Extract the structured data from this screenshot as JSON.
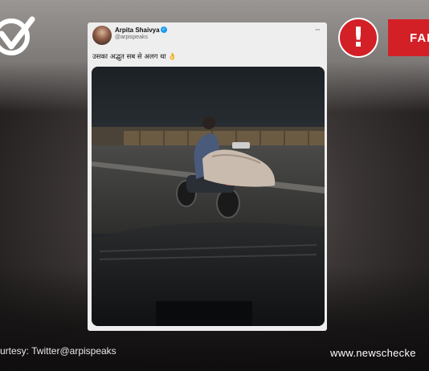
{
  "tweet": {
    "author_name": "Arpita Shaivya",
    "author_handle": "@arpispeaks",
    "text": "उसका अद्भुत सब से अलग था 👌",
    "more_glyph": "···",
    "verified_glyph": "✓"
  },
  "overlay": {
    "alert_glyph": "!",
    "verdict": "FAL",
    "credit": "urtesy: Twitter@arpispeaks",
    "site": "www.newschecke"
  },
  "colors": {
    "alert_red": "#d32027",
    "verified_blue": "#1d9bf0",
    "card_bg": "#eeeeef"
  },
  "icons": [
    "newschecker-logo-icon",
    "alert-icon",
    "verified-icon",
    "more-options-icon"
  ]
}
